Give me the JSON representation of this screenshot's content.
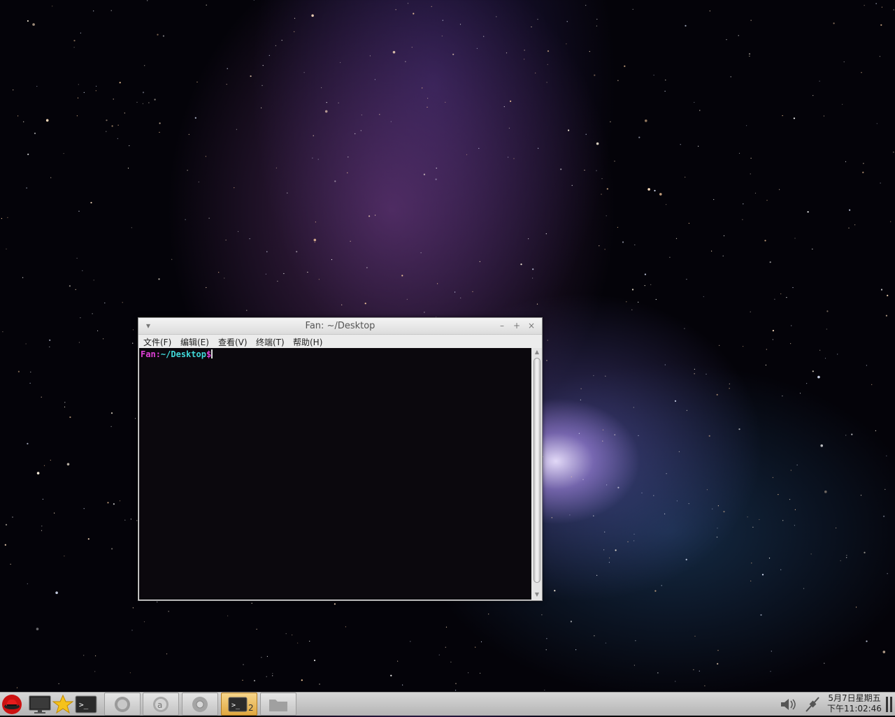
{
  "terminal": {
    "title": "Fan: ~/Desktop",
    "window_menu_glyph": "▾",
    "controls": {
      "minimize": "–",
      "maximize": "+",
      "close": "×"
    },
    "menu": [
      "文件(F)",
      "编辑(E)",
      "查看(V)",
      "终端(T)",
      "帮助(H)"
    ],
    "prompt_user": "Fan",
    "prompt_sep": ":",
    "prompt_path": "~/Desktop",
    "prompt_symbol": "$"
  },
  "taskbar": {
    "launchers": [
      "redhat-menu-icon",
      "show-desktop-icon",
      "favorites-star-icon",
      "terminal-launcher-icon"
    ],
    "tasks": [
      {
        "icon": "firefox-icon",
        "active": false
      },
      {
        "icon": "software-center-icon",
        "active": false
      },
      {
        "icon": "chrome-icon",
        "active": false
      },
      {
        "icon": "terminal-task-icon",
        "active": true,
        "count": "2"
      },
      {
        "icon": "file-manager-icon",
        "active": false
      }
    ],
    "tray": [
      "volume-icon",
      "network-icon"
    ],
    "clock_date": "5月7日星期五",
    "clock_time": "下午11:02:46"
  },
  "colors": {
    "prompt_user": "#e040d8",
    "prompt_path": "#40d8d8",
    "terminal_bg": "#0b080d",
    "active_task": "#e0a840"
  }
}
